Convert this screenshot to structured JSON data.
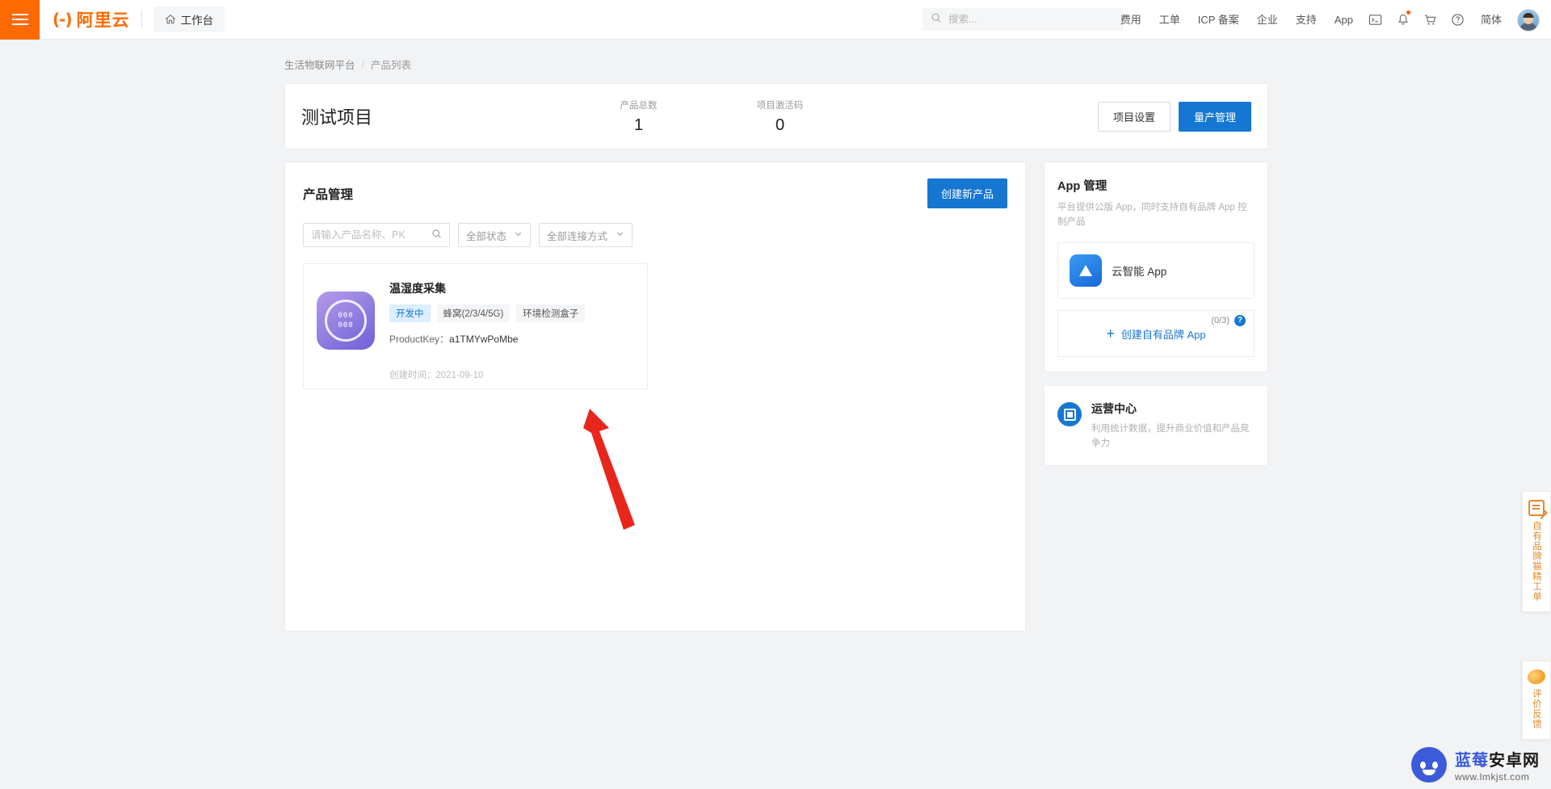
{
  "topbar": {
    "menu_icon": "hamburger-icon",
    "brand_mark": "(-)",
    "brand_text": "阿里云",
    "workbench_label": "工作台",
    "workbench_icon": "home-icon",
    "search": {
      "icon": "search-icon",
      "placeholder": "搜索...",
      "value": ""
    },
    "nav_items": [
      {
        "label": "费用"
      },
      {
        "label": "工单"
      },
      {
        "label": "ICP 备案"
      },
      {
        "label": "企业"
      },
      {
        "label": "支持"
      },
      {
        "label": "App"
      }
    ],
    "icons": [
      {
        "name": "terminal-icon"
      },
      {
        "name": "bell-icon",
        "has_badge": true
      },
      {
        "name": "cart-icon"
      },
      {
        "name": "help-circle-icon"
      }
    ],
    "language_label": "简体",
    "avatar_name": "user-avatar"
  },
  "breadcrumb": {
    "root": "生活物联网平台",
    "separator": "/",
    "current": "产品列表"
  },
  "project": {
    "title": "测试项目",
    "stats": [
      {
        "label": "产品总数",
        "value": "1"
      },
      {
        "label": "项目激活码",
        "value": "0"
      }
    ],
    "settings_button": "项目设置",
    "production_button": "量产管理"
  },
  "product_panel": {
    "title": "产品管理",
    "create_button": "创建新产品",
    "filters": {
      "search_placeholder": "请输入产品名称、PK",
      "search_value": "",
      "status_select": "全部状态",
      "connection_select": "全部连接方式"
    },
    "products": [
      {
        "name": "温湿度采集",
        "status_tag": "开发中",
        "tags": [
          "蜂窝(2/3/4/5G)",
          "环境检测盒子"
        ],
        "product_key_label": "ProductKey：",
        "product_key": "a1TMYwPoMbe",
        "created_label": "创建时间：2021-09-10",
        "icon_name": "sensor-product-icon",
        "icon_digits_top": "000",
        "icon_digits_bottom": "000"
      }
    ]
  },
  "app_panel": {
    "title": "App 管理",
    "description": "平台提供公版 App，同时支持自有品牌 App 控制产品",
    "app_row": {
      "name": "云智能 App",
      "icon_name": "cloud-intelligence-app-icon"
    },
    "create_app": {
      "plus": "+",
      "label": "创建自有品牌 App",
      "counter": "(0/3)",
      "help": "?"
    }
  },
  "ops_panel": {
    "title": "运营中心",
    "description": "利用统计数据，提升商业价值和产品竞争力",
    "icon_name": "operations-center-icon"
  },
  "rail": [
    {
      "icon": "ticket-check-icon",
      "text": "自有品牌猫精工单"
    },
    {
      "icon": "feedback-egg-icon",
      "text": "评价反馈"
    }
  ],
  "annotation": {
    "type": "red-arrow",
    "color": "#e8261c"
  },
  "watermark": {
    "title_part_1": "蓝莓",
    "title_part_2": "安卓网",
    "url": "www.lmkjst.com",
    "logo_name": "blueberry-android-logo"
  },
  "colors": {
    "brand_orange": "#ff6a00",
    "primary_blue": "#1677d2",
    "page_bg": "#f2f3f5",
    "status_tag_bg": "#dceeff"
  }
}
